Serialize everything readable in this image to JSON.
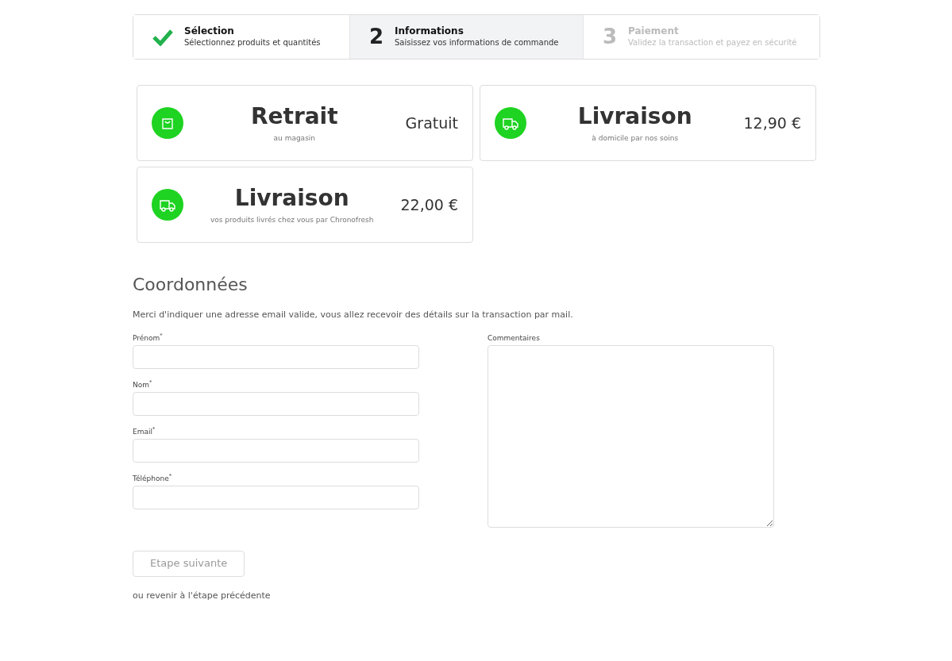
{
  "steps": [
    {
      "kind": "done",
      "selected": false,
      "title": "Sélection",
      "subtitle": "Sélectionnez produits et quantités"
    },
    {
      "kind": "numbered",
      "selected": true,
      "number": "2",
      "title": "Informations",
      "subtitle": "Saisissez vos informations de commande"
    },
    {
      "kind": "upcoming",
      "selected": false,
      "number": "3",
      "title": "Paiement",
      "subtitle": "Validez la transaction et payez en sécurité"
    }
  ],
  "delivery_options": [
    {
      "kind": "bag",
      "title": "Retrait",
      "subtitle": "au magasin",
      "price": "Gratuit"
    },
    {
      "kind": "truck",
      "title": "Livraison",
      "subtitle": "à domicile par nos soins",
      "price": "12,90 €"
    },
    {
      "kind": "truck",
      "title": "Livraison",
      "subtitle": "vos produits livrés chez vous par Chronofresh",
      "price": "22,00 €"
    }
  ],
  "contact": {
    "heading": "Coordonnées",
    "intro": "Merci d'indiquer une adresse email valide, vous allez recevoir des détails sur la transaction par mail.",
    "fields": [
      {
        "label": "Prénom$^{*}$"
      },
      {
        "label": "Nom$^{*}$"
      },
      {
        "label": "Email$^{*}$"
      },
      {
        "label": "Téléphone$^{*}$"
      }
    ],
    "comments_label": "Commentaires"
  },
  "next_button": {
    "label": "Etape suivante",
    "disabled": true
  },
  "back_link": "ou revenir à l'étape précédente"
}
